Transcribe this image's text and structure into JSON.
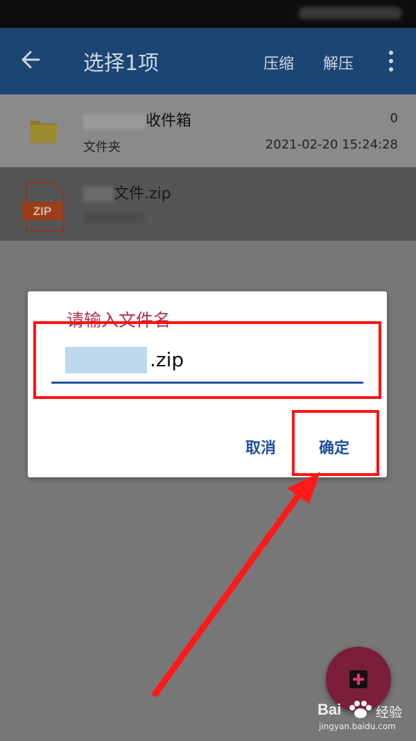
{
  "appbar": {
    "title": "选择1项",
    "actions": {
      "compress": "压缩",
      "extract": "解压"
    }
  },
  "files": [
    {
      "name": "收件箱",
      "type": "文件夹",
      "count": "0",
      "date": "2021-02-20 15:24:28",
      "icon": "folder-icon"
    },
    {
      "name": "文件.zip",
      "type": "",
      "icon": "zip-file-icon",
      "icon_label": "ZIP"
    }
  ],
  "dialog": {
    "title": "请输入文件名",
    "input_value": ".zip",
    "cancel_label": "取消",
    "ok_label": "确定"
  },
  "watermark": {
    "brand": "Bai",
    "brand2": "经验",
    "url": "jingyan.baidu.com"
  },
  "colors": {
    "appbar": "#1b4573",
    "dialog_title": "#b0304c",
    "accent": "#1f4ea0",
    "highlight": "#ff1111",
    "fab": "#7a1e3a"
  }
}
